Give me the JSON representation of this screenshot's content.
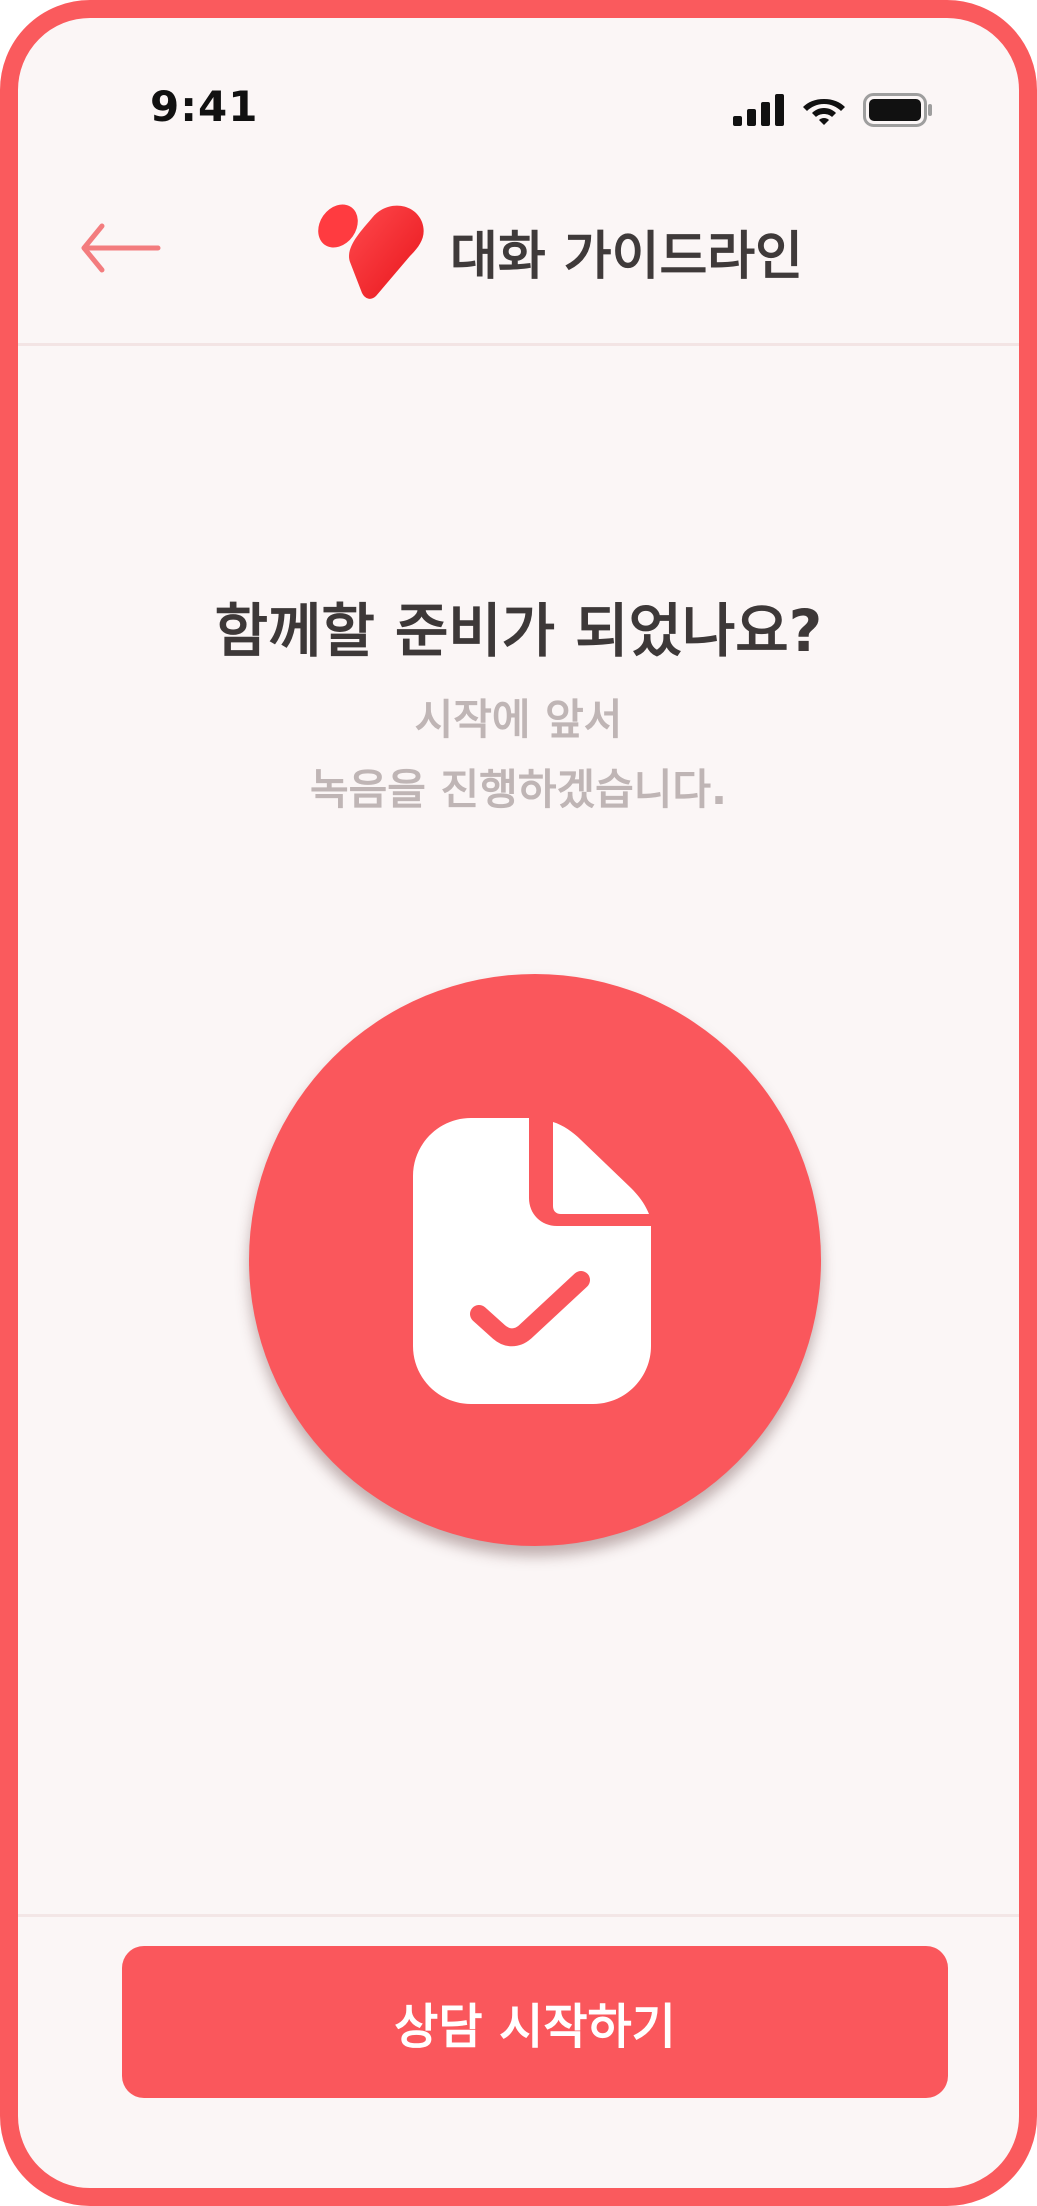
{
  "status_bar": {
    "time": "9:41",
    "icons": [
      "cellular-signal-icon",
      "wifi-icon",
      "battery-icon"
    ]
  },
  "header": {
    "back_icon": "arrow-left-icon",
    "logo_icon": "heart-logo-icon",
    "title": "대화 가이드라인"
  },
  "main": {
    "question": "함께할 준비가 되었나요?",
    "subtitle_line1": "시작에 앞서",
    "subtitle_line2": "녹음을 진행하겠습니다.",
    "record_icon": "document-check-icon"
  },
  "footer": {
    "start_button_label": "상담 시작하기"
  },
  "colors": {
    "accent": "#FA575C",
    "frame": "#FA5A5D",
    "background": "#FBF6F6",
    "title_text": "#3D3838",
    "subtitle_text": "#BFB5B5"
  }
}
